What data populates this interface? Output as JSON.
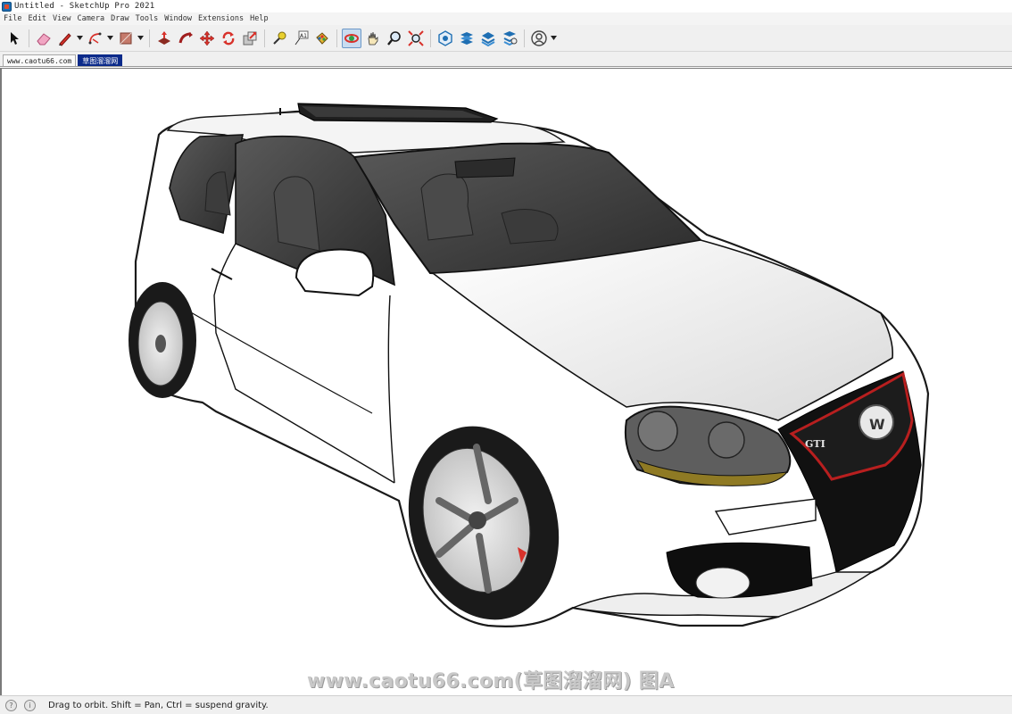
{
  "window": {
    "title": "Untitled - SketchUp Pro 2021"
  },
  "menu": [
    "File",
    "Edit",
    "View",
    "Camera",
    "Draw",
    "Tools",
    "Window",
    "Extensions",
    "Help"
  ],
  "toolbar": {
    "tools": [
      {
        "name": "select-icon"
      },
      {
        "name": "eraser-icon"
      },
      {
        "name": "pencil-line-icon"
      },
      {
        "name": "arc-icon"
      },
      {
        "name": "rectangle-icon"
      },
      {
        "name": "push-pull-icon"
      },
      {
        "name": "follow-me-icon"
      },
      {
        "name": "move-icon"
      },
      {
        "name": "rotate-icon"
      },
      {
        "name": "scale-icon"
      },
      {
        "name": "tape-measure-icon"
      },
      {
        "name": "text-icon"
      },
      {
        "name": "paint-bucket-icon"
      },
      {
        "name": "orbit-icon"
      },
      {
        "name": "pan-icon"
      },
      {
        "name": "zoom-icon"
      },
      {
        "name": "zoom-extents-icon"
      },
      {
        "name": "warehouse-icon"
      },
      {
        "name": "extension-warehouse-icon"
      },
      {
        "name": "layout-icon"
      },
      {
        "name": "extension-manager-icon"
      },
      {
        "name": "account-icon"
      }
    ]
  },
  "scenes": [
    "www.caotu66.com",
    "草图溜溜网"
  ],
  "watermark": "www.caotu66.com(草图溜溜网) 图A",
  "model_labels": {
    "badge": "GTI"
  },
  "status": {
    "message": "Drag to orbit. Shift = Pan, Ctrl = suspend gravity."
  }
}
